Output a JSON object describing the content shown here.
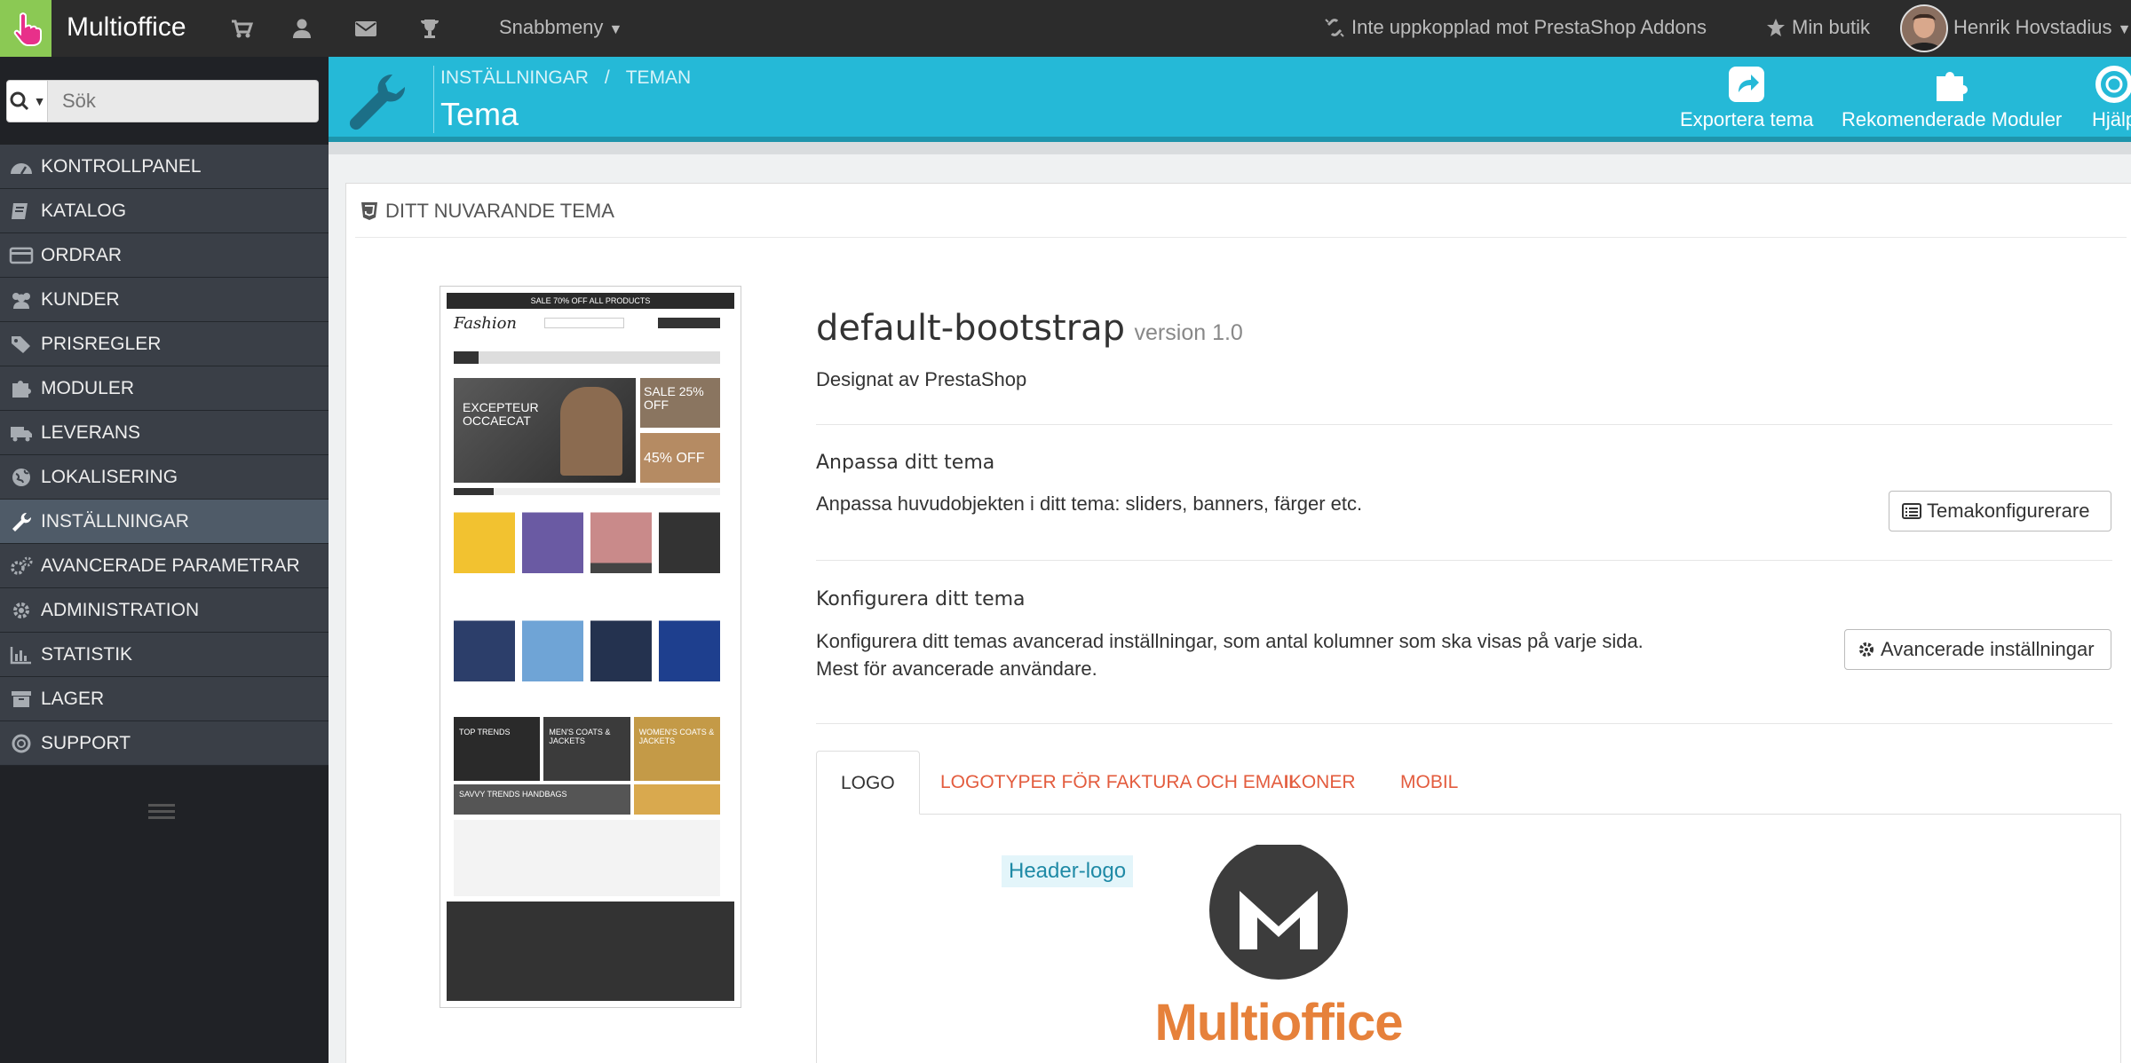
{
  "topbar": {
    "brand": "Multioffice",
    "quick_access": "Snabbmeny",
    "addons_status": "Inte uppkopplad mot PrestaShop Addons",
    "my_store": "Min butik",
    "user_name": "Henrik Hovstadius"
  },
  "sidebar": {
    "search_placeholder": "Sök",
    "items": [
      {
        "label": "KONTROLLPANEL",
        "icon": "dashboard-icon"
      },
      {
        "label": "KATALOG",
        "icon": "book-icon"
      },
      {
        "label": "ORDRAR",
        "icon": "credit-card-icon"
      },
      {
        "label": "KUNDER",
        "icon": "users-icon"
      },
      {
        "label": "PRISREGLER",
        "icon": "tags-icon"
      },
      {
        "label": "MODULER",
        "icon": "puzzle-icon"
      },
      {
        "label": "LEVERANS",
        "icon": "truck-icon"
      },
      {
        "label": "LOKALISERING",
        "icon": "globe-icon"
      },
      {
        "label": "INSTÄLLNINGAR",
        "icon": "wrench-icon"
      },
      {
        "label": "AVANCERADE PARAMETRAR",
        "icon": "cogs-icon"
      },
      {
        "label": "ADMINISTRATION",
        "icon": "cog-icon"
      },
      {
        "label": "STATISTIK",
        "icon": "bar-chart-icon"
      },
      {
        "label": "LAGER",
        "icon": "archive-icon"
      },
      {
        "label": "SUPPORT",
        "icon": "lifebuoy-icon"
      }
    ],
    "active_index": 8
  },
  "header": {
    "breadcrumb": [
      "INSTÄLLNINGAR",
      "/",
      "TEMAN"
    ],
    "title": "Tema",
    "toolbar": {
      "export_label": "Exportera tema",
      "modules_label": "Rekomenderade Moduler",
      "help_label": "Hjälp"
    }
  },
  "panel": {
    "heading": "DITT NUVARANDE TEMA",
    "theme_name": "default-bootstrap",
    "theme_version": "version 1.0",
    "designer": "Designat av PrestaShop",
    "customize": {
      "title": "Anpassa ditt tema",
      "text": "Anpassa huvudobjekten i ditt tema: sliders, banners, färger etc.",
      "button": "Temakonfigurerare"
    },
    "configure": {
      "title": "Konfigurera ditt tema",
      "text_line1": "Konfigurera ditt temas avancerad inställningar, som antal kolumner som ska visas på varje sida.",
      "text_line2": "Mest för avancerade användare.",
      "button": "Avancerade inställningar"
    },
    "tabs": [
      "LOGO",
      "LOGOTYPER FÖR FAKTURA OCH EMAIL",
      "IKONER",
      "MOBIL"
    ],
    "active_tab": 0,
    "header_logo_label": "Header-logo",
    "logo_text": "Multioffice"
  },
  "preview": {
    "banner": "SALE 70% OFF ALL PRODUCTS",
    "shop_name": "Fashion",
    "hero_text": "EXCEPTEUR OCCAECAT",
    "sale_1": "SALE 25% OFF",
    "sale_2": "45% OFF",
    "promo_1": "TOP TRENDS",
    "promo_2": "MEN'S COATS & JACKETS",
    "promo_3": "WOMEN'S COATS & JACKETS",
    "promo_4": "SAVVY TRENDS HANDBAGS"
  },
  "colors": {
    "accent": "#25b9d7",
    "sidebar": "#3a3f47",
    "tab_link": "#e35c3e",
    "logo_orange": "#e6813b",
    "logo_dark": "#3c3c3c"
  }
}
